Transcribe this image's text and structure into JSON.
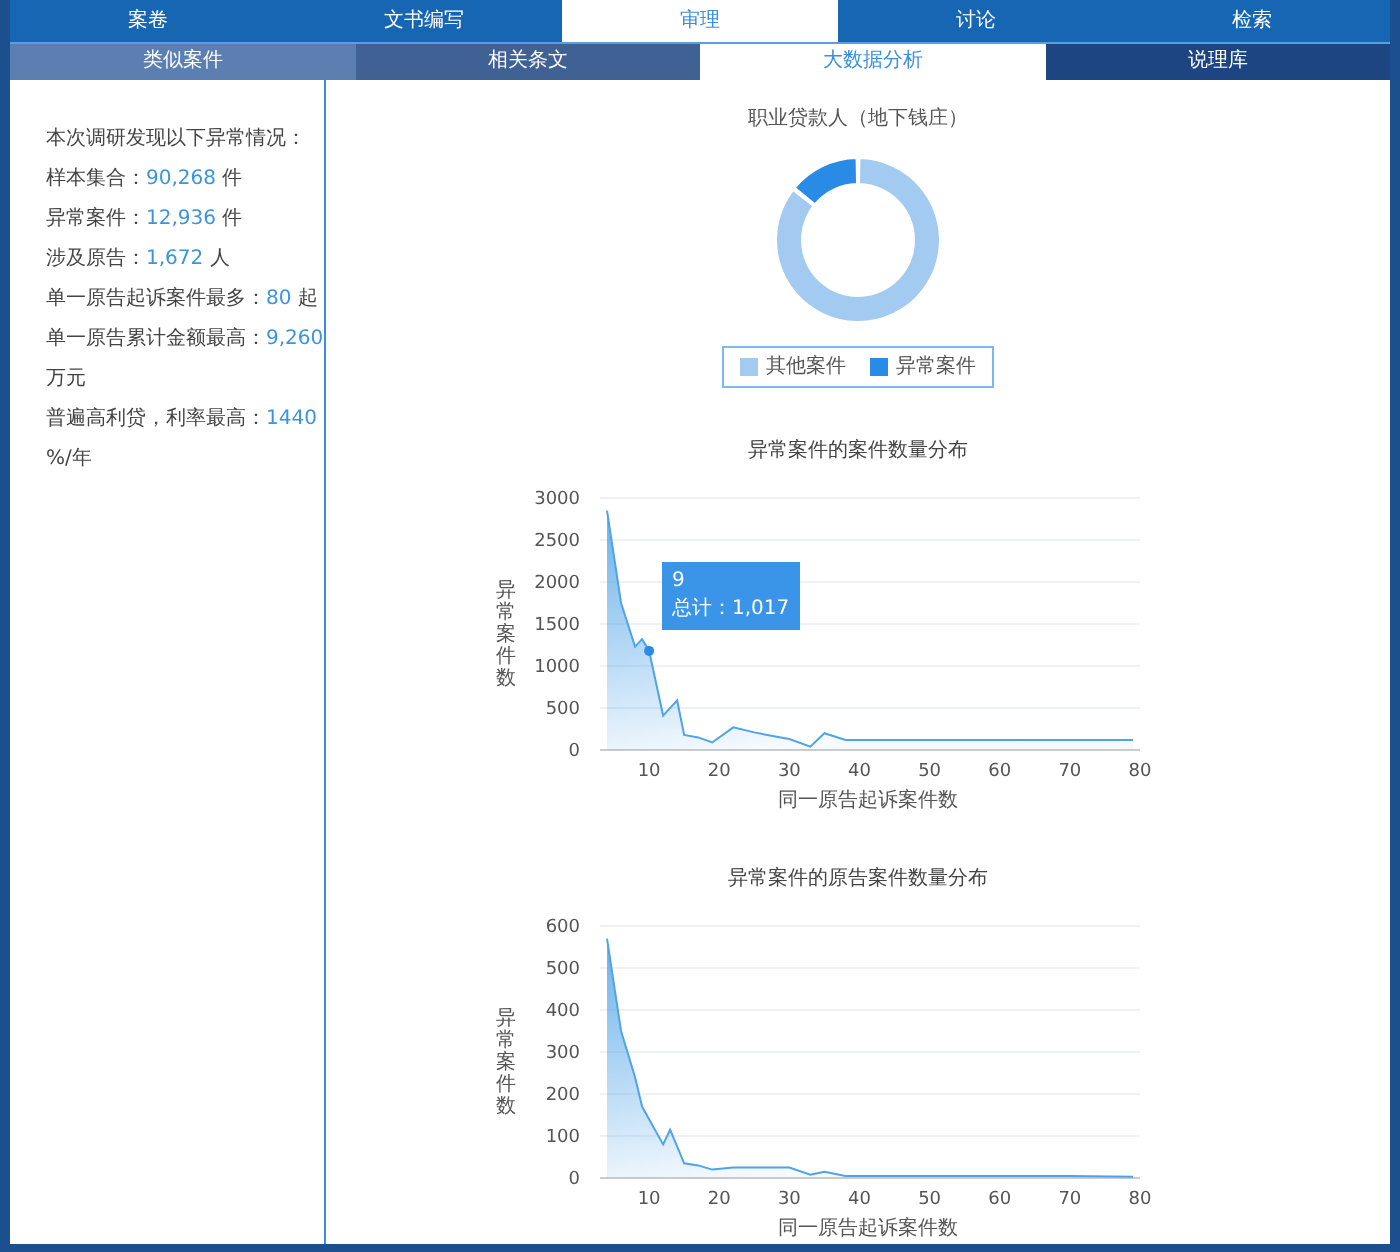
{
  "tabs": [
    {
      "label": "案卷",
      "selected": false
    },
    {
      "label": "文书编写",
      "selected": false
    },
    {
      "label": "审理",
      "selected": true
    },
    {
      "label": "讨论",
      "selected": false
    },
    {
      "label": "检索",
      "selected": false
    }
  ],
  "subtabs": [
    {
      "label": "类似案件",
      "selected": false,
      "color": "#5b7fb1"
    },
    {
      "label": "相关条文",
      "selected": false,
      "color": "#3f6194"
    },
    {
      "label": "大数据分析",
      "selected": true,
      "color": "#ffffff"
    },
    {
      "label": "说理库",
      "selected": false,
      "color": "#1d4581"
    }
  ],
  "summary": {
    "heading": "本次调研发现以下异常情况：",
    "lines": [
      {
        "label": "样本集合：",
        "value": "90,268",
        "unit": "件"
      },
      {
        "label": "异常案件：",
        "value": "12,936",
        "unit": "件"
      },
      {
        "label": "涉及原告：",
        "value": "1,672",
        "unit": "人"
      },
      {
        "label": "单一原告起诉案件最多：",
        "value": "80",
        "unit": "起"
      },
      {
        "label": "单一原告累计金额最高：",
        "value": "9,260",
        "unit": "万元"
      },
      {
        "label": "普遍高利贷，利率最高：",
        "value": "1440",
        "unit": "%/年"
      }
    ]
  },
  "donut": {
    "chart_data": {
      "type": "donut",
      "title": "职业贷款人（地下钱庄）",
      "categories": [
        "其他案件",
        "异常案件"
      ],
      "values": [
        85.7,
        14.3
      ],
      "colors": [
        "#a3cbf2",
        "#2a8be6"
      ]
    }
  },
  "case_chart": {
    "chart_data": {
      "type": "area",
      "title": "异常案件的案件数量分布",
      "xlabel": "同一原告起诉案件数",
      "ylabel": "异常案件数",
      "x": [
        4,
        6,
        8,
        9,
        10,
        12,
        14,
        15,
        17,
        19,
        22,
        25,
        28,
        30,
        33,
        35,
        38,
        40,
        50,
        60,
        70,
        79
      ],
      "series": [
        {
          "color": "#4fa3e8",
          "values": [
            2850,
            1750,
            1230,
            1320,
            1180,
            410,
            590,
            180,
            150,
            90,
            270,
            210,
            160,
            130,
            40,
            200,
            120,
            120,
            120,
            120,
            120,
            120
          ]
        }
      ],
      "grid": true,
      "xlim": [
        3,
        80
      ],
      "ylim": [
        0,
        3000
      ],
      "xticks": [
        10,
        20,
        30,
        40,
        50,
        60,
        70,
        80
      ],
      "yticks": [
        0,
        500,
        1000,
        1500,
        2000,
        2500,
        3000
      ]
    },
    "tooltip": {
      "title": "9",
      "text": "总计：1,017"
    }
  },
  "plaintiff_chart": {
    "chart_data": {
      "type": "area",
      "title": "异常案件的原告案件数量分布",
      "xlabel": "同一原告起诉案件数",
      "ylabel": "异常案件数",
      "x": [
        4,
        6,
        8,
        9,
        10,
        12,
        13,
        15,
        17,
        19,
        22,
        25,
        28,
        30,
        33,
        35,
        38,
        40,
        50,
        60,
        70,
        79
      ],
      "series": [
        {
          "color": "#4fa3e8",
          "values": [
            570,
            350,
            240,
            170,
            140,
            80,
            115,
            35,
            30,
            20,
            25,
            25,
            25,
            25,
            8,
            15,
            5,
            5,
            5,
            5,
            5,
            3
          ]
        }
      ],
      "grid": true,
      "xlim": [
        3,
        80
      ],
      "ylim": [
        0,
        600
      ],
      "xticks": [
        10,
        20,
        30,
        40,
        50,
        60,
        70,
        80
      ],
      "yticks": [
        0,
        100,
        200,
        300,
        400,
        500,
        600
      ]
    }
  }
}
